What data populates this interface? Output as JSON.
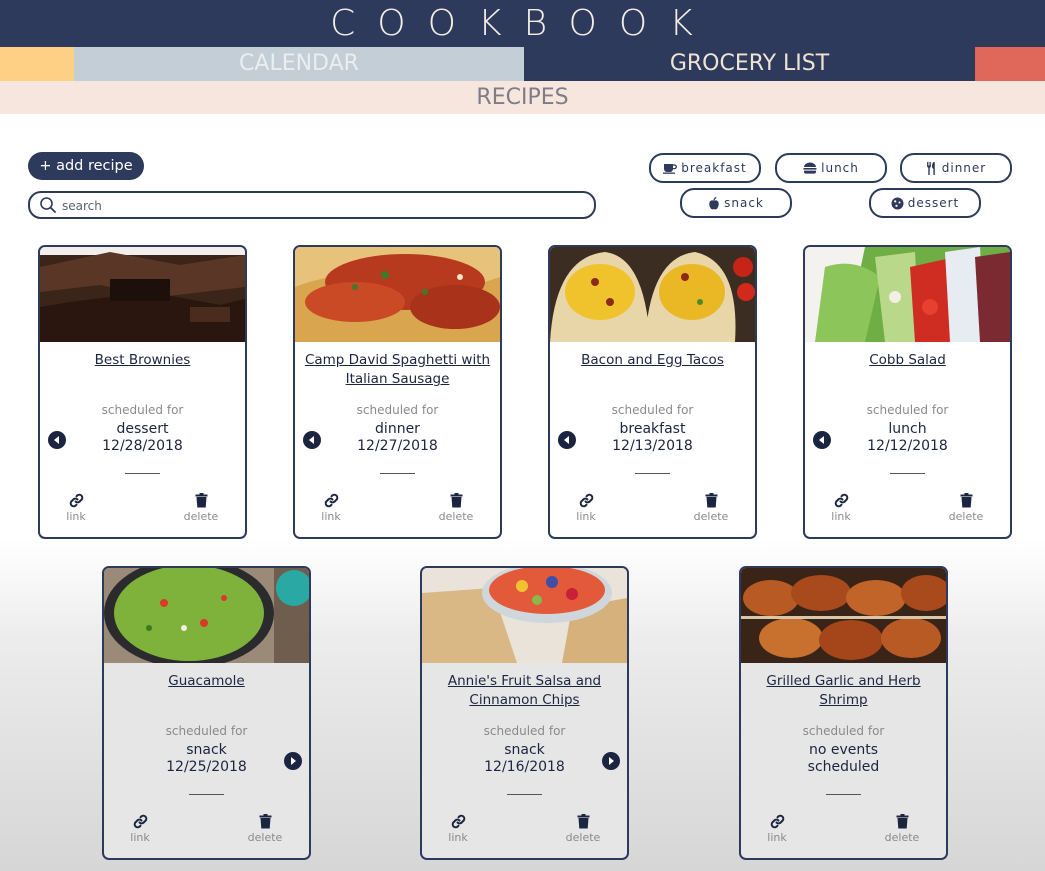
{
  "app": {
    "title": "COOKBOOK"
  },
  "nav": {
    "calendar": "CALENDAR",
    "grocery": "GROCERY LIST",
    "recipes": "RECIPES"
  },
  "toolbar": {
    "add_label": "+ add recipe",
    "search_placeholder": "search"
  },
  "filters": [
    {
      "label": "breakfast",
      "icon": "coffee-cup-icon"
    },
    {
      "label": "lunch",
      "icon": "burger-icon"
    },
    {
      "label": "dinner",
      "icon": "utensils-icon"
    },
    {
      "label": "snack",
      "icon": "apple-icon"
    },
    {
      "label": "dessert",
      "icon": "cookie-icon"
    }
  ],
  "card_common": {
    "scheduled_label": "scheduled for",
    "link_label": "link",
    "delete_label": "delete"
  },
  "recipes": [
    {
      "title": "Best Brownies",
      "meal": "dessert",
      "date": "12/28/2018",
      "arrow": "left"
    },
    {
      "title": "Camp David Spaghetti with Italian Sausage",
      "meal": "dinner",
      "date": "12/27/2018",
      "arrow": "left"
    },
    {
      "title": "Bacon and Egg Tacos",
      "meal": "breakfast",
      "date": "12/13/2018",
      "arrow": "left"
    },
    {
      "title": "Cobb Salad",
      "meal": "lunch",
      "date": "12/12/2018",
      "arrow": "left"
    },
    {
      "title": "Guacamole",
      "meal": "snack",
      "date": "12/25/2018",
      "arrow": "right"
    },
    {
      "title": "Annie's Fruit Salsa and Cinnamon Chips",
      "meal": "snack",
      "date": "12/16/2018",
      "arrow": "right"
    },
    {
      "title": "Grilled Garlic and Herb Shrimp",
      "meal": "no events",
      "date": "scheduled",
      "arrow": "none"
    }
  ],
  "colors": {
    "navy": "#2e3a5c",
    "peach": "#f6e6de",
    "yellow": "#fdd086",
    "coral": "#e0685a",
    "slate": "#c3ced6"
  }
}
